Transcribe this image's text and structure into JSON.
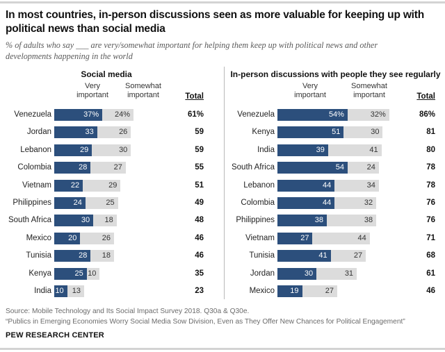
{
  "title": "In most countries, in-person discussions seen as more valuable for keeping up with political news than social media",
  "subtitle": "% of adults who say ___ are very/somewhat important for helping them keep up with political news and other developments happening in the world",
  "columns": {
    "very": "Very\nimportant",
    "very_line1": "Very",
    "very_line2": "important",
    "somewhat_line1": "Somewhat",
    "somewhat_line2": "important",
    "total": "Total"
  },
  "panels": [
    {
      "id": "social-media",
      "title": "Social media"
    },
    {
      "id": "in-person-discussions",
      "title": "In-person discussions with people they see regularly"
    }
  ],
  "source": {
    "line1": "Source: Mobile Technology and Its Social Impact Survey 2018. Q30a & Q30e.",
    "line2": "“Publics in Emerging Economies Worry Social Media Sow Division, Even as They Offer New Chances for Political Engagement”",
    "org": "PEW RESEARCH CENTER"
  },
  "colors": {
    "very": "#2c4f7c",
    "somewhat": "#dcdcdc",
    "rule": "#d3d3d3",
    "divider": "#b8b8b8"
  },
  "chart_data": [
    {
      "type": "bar",
      "title": "Social media",
      "subtitle": "% of adults who say social media are very/somewhat important for helping them keep up with political news and other developments happening in the world",
      "orientation": "horizontal",
      "stacked": true,
      "xlabel": "",
      "ylabel": "",
      "xlim": [
        0,
        100
      ],
      "grid": false,
      "legend": [
        "Very important",
        "Somewhat important"
      ],
      "legend_position": "top",
      "categories": [
        "Venezuela",
        "Jordan",
        "Lebanon",
        "Colombia",
        "Vietnam",
        "Philippines",
        "South Africa",
        "Mexico",
        "Tunisia",
        "Kenya",
        "India"
      ],
      "series": [
        {
          "name": "Very important",
          "values": [
            37,
            33,
            29,
            28,
            22,
            24,
            30,
            20,
            28,
            25,
            10
          ]
        },
        {
          "name": "Somewhat important",
          "values": [
            24,
            26,
            30,
            27,
            29,
            25,
            18,
            26,
            18,
            10,
            13
          ]
        }
      ],
      "totals": [
        61,
        59,
        59,
        55,
        51,
        49,
        48,
        46,
        46,
        35,
        23
      ],
      "value_labels": [
        [
          "37%",
          "24%",
          "61%"
        ],
        [
          "33",
          "26",
          "59"
        ],
        [
          "29",
          "30",
          "59"
        ],
        [
          "28",
          "27",
          "55"
        ],
        [
          "22",
          "29",
          "51"
        ],
        [
          "24",
          "25",
          "49"
        ],
        [
          "30",
          "18",
          "48"
        ],
        [
          "20",
          "26",
          "46"
        ],
        [
          "28",
          "18",
          "46"
        ],
        [
          "25",
          "10",
          "35"
        ],
        [
          "10",
          "13",
          "23"
        ]
      ]
    },
    {
      "type": "bar",
      "title": "In-person discussions with people they see regularly",
      "subtitle": "% of adults who say in-person discussions with people they see regularly are very/somewhat important for helping them keep up with political news and other developments happening in the world",
      "orientation": "horizontal",
      "stacked": true,
      "xlabel": "",
      "ylabel": "",
      "xlim": [
        0,
        100
      ],
      "grid": false,
      "legend": [
        "Very important",
        "Somewhat important"
      ],
      "legend_position": "top",
      "categories": [
        "Venezuela",
        "Kenya",
        "India",
        "South Africa",
        "Lebanon",
        "Colombia",
        "Philippines",
        "Vietnam",
        "Tunisia",
        "Jordan",
        "Mexico"
      ],
      "series": [
        {
          "name": "Very important",
          "values": [
            54,
            51,
            39,
            54,
            44,
            44,
            38,
            27,
            41,
            30,
            19
          ]
        },
        {
          "name": "Somewhat important",
          "values": [
            32,
            30,
            41,
            24,
            34,
            32,
            38,
            44,
            27,
            31,
            27
          ]
        }
      ],
      "totals": [
        86,
        81,
        80,
        78,
        78,
        76,
        76,
        71,
        68,
        61,
        46
      ],
      "value_labels": [
        [
          "54%",
          "32%",
          "86%"
        ],
        [
          "51",
          "30",
          "81"
        ],
        [
          "39",
          "41",
          "80"
        ],
        [
          "54",
          "24",
          "78"
        ],
        [
          "44",
          "34",
          "78"
        ],
        [
          "44",
          "32",
          "76"
        ],
        [
          "38",
          "38",
          "76"
        ],
        [
          "27",
          "44",
          "71"
        ],
        [
          "41",
          "27",
          "68"
        ],
        [
          "30",
          "31",
          "61"
        ],
        [
          "19",
          "27",
          "46"
        ]
      ]
    }
  ]
}
